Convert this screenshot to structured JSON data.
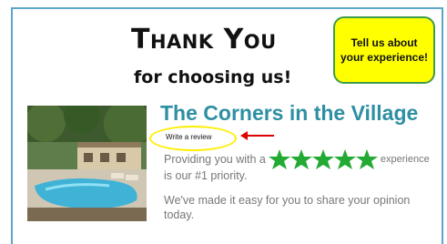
{
  "heading": {
    "title": "Thank You",
    "subtitle": "for choosing us!"
  },
  "callout": {
    "text": "Tell us about your experience!"
  },
  "photo": {
    "icon": "apartment-pool-photo"
  },
  "community": {
    "name": "The Corners in the Village"
  },
  "review": {
    "link_label": "Write a review"
  },
  "message": {
    "line1_before": "Providing you with a",
    "rating": {
      "value": 5,
      "max": 5
    },
    "line1_after": "experience",
    "line2": "is our #1 priority.",
    "paragraph2": "We've made it easy for you to share your opinion today."
  },
  "colors": {
    "border": "#5aa7c9",
    "callout_fill": "#ffff00",
    "callout_border": "#3f9b4a",
    "community_name": "#2e8fa3",
    "stars": "#22aa33",
    "highlight_ring": "#ffee00",
    "arrow": "#dd0000",
    "body_text": "#777777"
  }
}
